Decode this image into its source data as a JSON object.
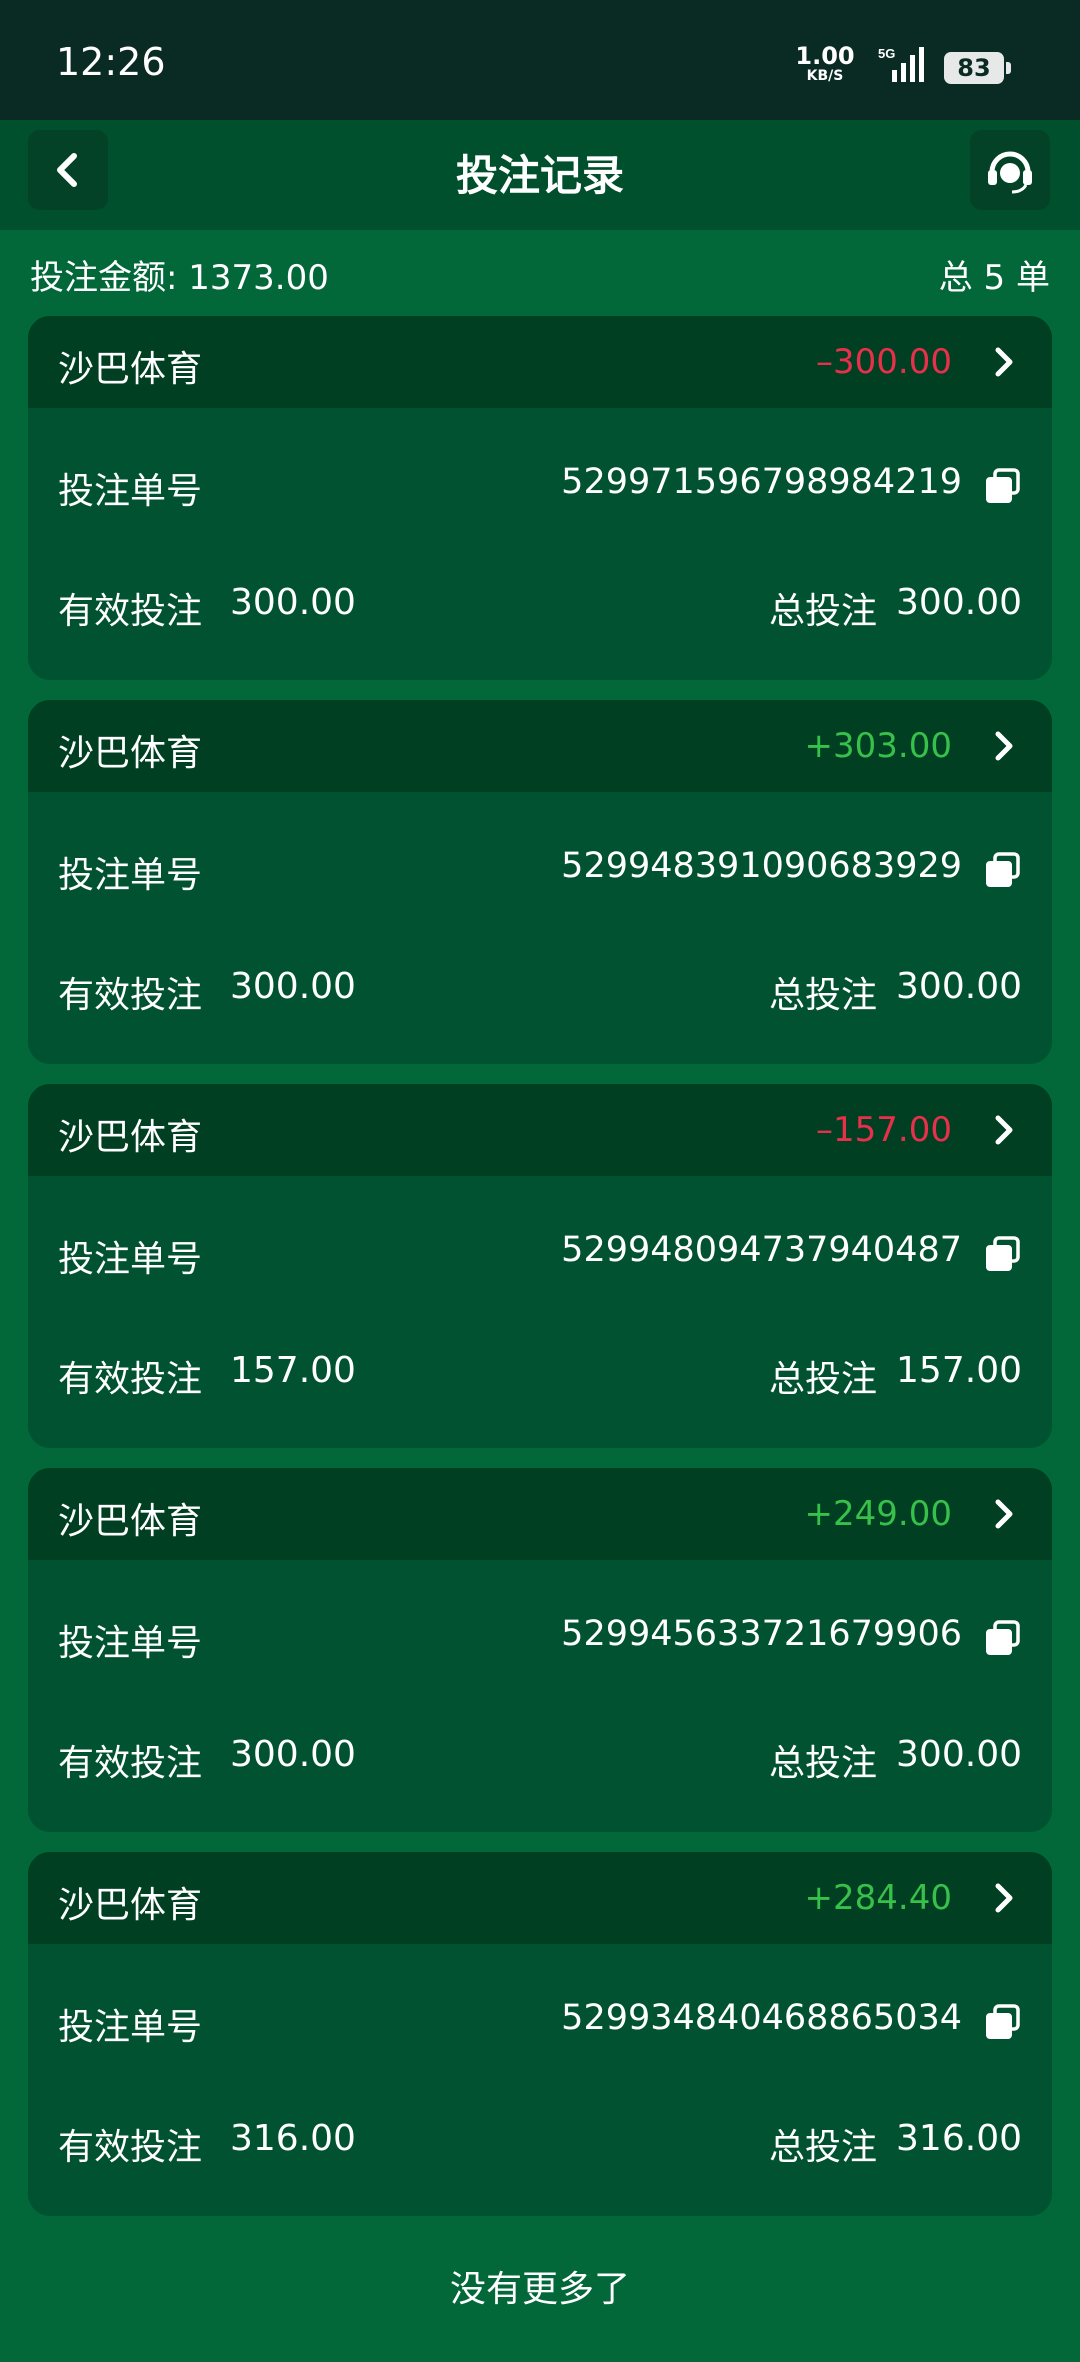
{
  "status_bar": {
    "time": "12:26",
    "net_speed_value": "1.00",
    "net_speed_unit": "KB/S",
    "network": "5G",
    "battery": "83"
  },
  "header": {
    "title": "投注记录"
  },
  "summary": {
    "amount_text": "投注金额: 1373.00",
    "count_text": "总 5 单"
  },
  "labels": {
    "order_no": "投注单号",
    "effective_bet": "有效投注",
    "total_bet": "总投注"
  },
  "records": [
    {
      "platform": "沙巴体育",
      "result": "–300.00",
      "result_sign": "negative",
      "order_no": "529971596798984219",
      "effective_bet": "300.00",
      "total_bet": "300.00"
    },
    {
      "platform": "沙巴体育",
      "result": "+303.00",
      "result_sign": "positive",
      "order_no": "529948391090683929",
      "effective_bet": "300.00",
      "total_bet": "300.00"
    },
    {
      "platform": "沙巴体育",
      "result": "–157.00",
      "result_sign": "negative",
      "order_no": "529948094737940487",
      "effective_bet": "157.00",
      "total_bet": "157.00"
    },
    {
      "platform": "沙巴体育",
      "result": "+249.00",
      "result_sign": "positive",
      "order_no": "529945633721679906",
      "effective_bet": "300.00",
      "total_bet": "300.00"
    },
    {
      "platform": "沙巴体育",
      "result": "+284.40",
      "result_sign": "positive",
      "order_no": "529934840468865034",
      "effective_bet": "316.00",
      "total_bet": "316.00"
    }
  ],
  "footer": {
    "no_more": "没有更多了"
  },
  "colors": {
    "negative": "#e8304a",
    "positive": "#37c04a",
    "background": "#02683a",
    "card": "#005230",
    "card_header": "#013f23"
  },
  "icons": {
    "back": "chevron-left-icon",
    "customer_service": "headset-icon",
    "detail": "chevron-right-icon",
    "copy": "copy-icon"
  }
}
